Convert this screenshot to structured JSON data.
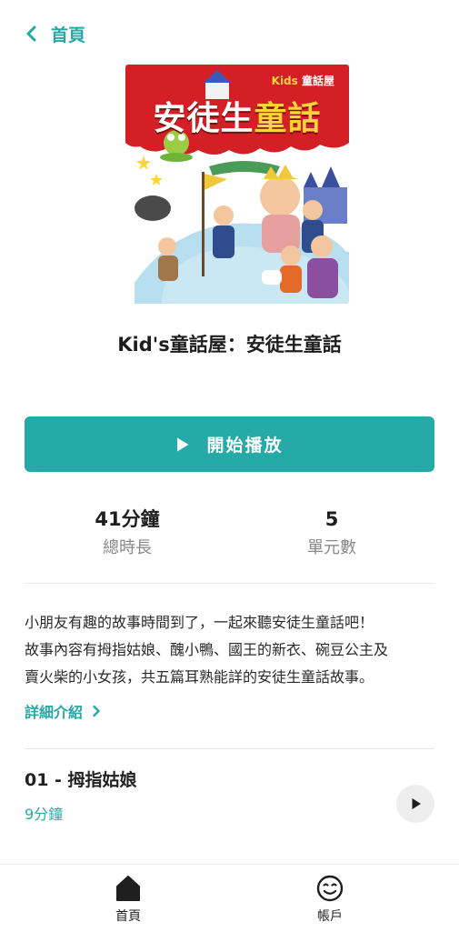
{
  "header": {
    "back_label": "首頁"
  },
  "cover": {
    "title_main": "安徒生",
    "title_accent": "童話",
    "brand_prefix": "Kids",
    "brand_suffix": "童話屋"
  },
  "book": {
    "title": "Kid's童話屋：安徒生童話"
  },
  "play_button": {
    "label": "開始播放"
  },
  "stats": {
    "duration_value": "41分鐘",
    "duration_label": "總時長",
    "units_value": "5",
    "units_label": "單元數"
  },
  "description": {
    "lines": [
      "小朋友有趣的故事時間到了，一起來聽安徒生童話吧！",
      "故事內容有拇指姑娘、醜小鴨、國王的新衣、碗豆公主及",
      "賣火柴的小女孩，共五篇耳熟能詳的安徒生童話故事。"
    ],
    "more_label": "詳細介紹"
  },
  "episodes": [
    {
      "title": "01 - 拇指姑娘",
      "duration": "9分鐘"
    }
  ],
  "tabbar": {
    "home_label": "首頁",
    "account_label": "帳戶"
  },
  "colors": {
    "accent": "#26aaa7",
    "cover_red": "#d41f26",
    "text": "#1e1e1e",
    "muted": "#888888"
  },
  "icons": {
    "back": "chevron-left-icon",
    "play": "play-icon",
    "more": "chevron-right-icon",
    "home": "home-icon",
    "account": "smiley-face-icon"
  }
}
